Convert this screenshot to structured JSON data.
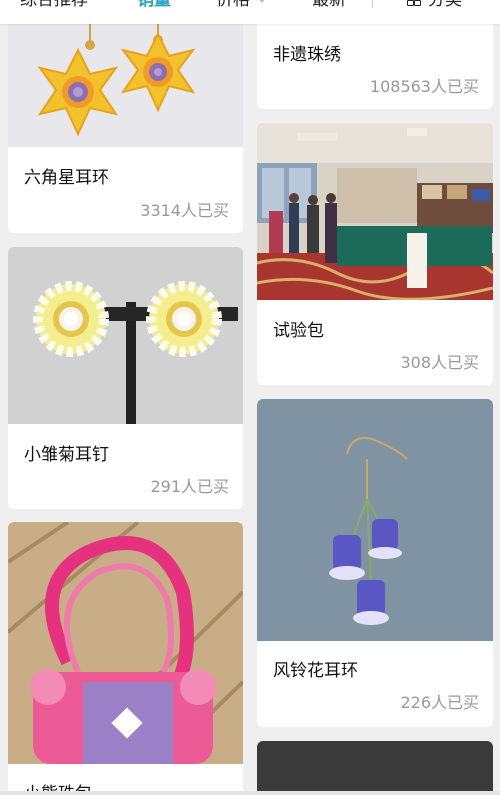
{
  "sort_tabs": [
    {
      "label": "综合推荐",
      "active": false
    },
    {
      "label": "销量",
      "active": true
    },
    {
      "label": "价格",
      "active": false
    },
    {
      "label": "最新",
      "active": false
    }
  ],
  "category_label": "分类",
  "products": [
    {
      "title": "六角星耳环",
      "sales": "3314人已买",
      "image": "star-earring-image"
    },
    {
      "title": "非遗珠绣",
      "sales": "108563人已买",
      "image": "bead-embroidery-image"
    },
    {
      "title": "试验包",
      "sales": "308人已买",
      "image": "exhibition-room-image"
    },
    {
      "title": "小雏菊耳钉",
      "sales": "291人已买",
      "image": "daisy-stud-image"
    },
    {
      "title": "风铃花耳环",
      "sales": "226人已买",
      "image": "bellflower-earring-image"
    },
    {
      "title": "小熊珠包",
      "sales": "",
      "image": "bead-bag-image"
    }
  ],
  "colors": {
    "accent": "#29a3c7",
    "background": "#efefef",
    "card": "#ffffff",
    "title": "#111111",
    "sales": "#999999"
  }
}
